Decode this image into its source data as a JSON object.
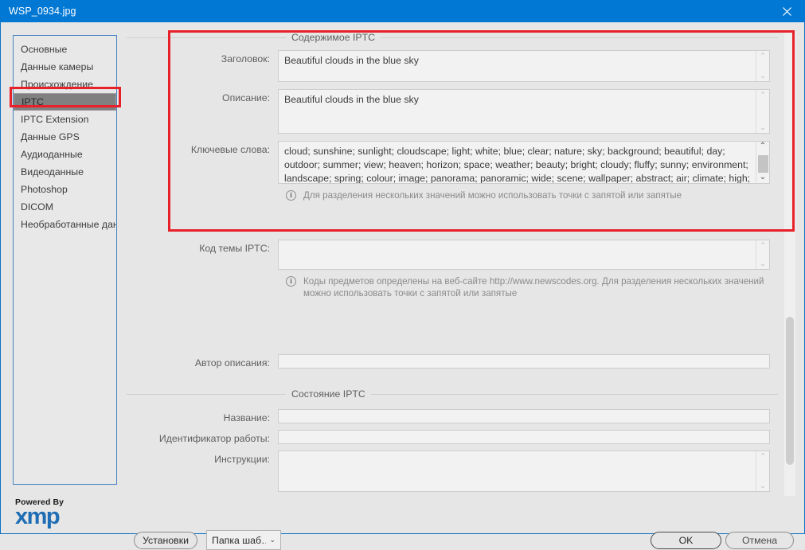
{
  "window": {
    "title": "WSP_0934.jpg",
    "close_icon": "close-icon",
    "titlebar_color": "#0078d4"
  },
  "sidebar": {
    "items": [
      {
        "label": "Основные",
        "selected": false
      },
      {
        "label": "Данные камеры",
        "selected": false
      },
      {
        "label": "Происхождение",
        "selected": false
      },
      {
        "label": "IPTC",
        "selected": true
      },
      {
        "label": "IPTC Extension",
        "selected": false
      },
      {
        "label": "Данные GPS",
        "selected": false
      },
      {
        "label": "Аудиоданные",
        "selected": false
      },
      {
        "label": "Видеоданные",
        "selected": false
      },
      {
        "label": "Photoshop",
        "selected": false
      },
      {
        "label": "DICOM",
        "selected": false
      },
      {
        "label": "Необработанные дан…",
        "selected": false
      }
    ],
    "selected_highlight_color": "#808080"
  },
  "branding": {
    "powered_by": "Powered By",
    "product": "xmp",
    "product_color": "#1f6eb5"
  },
  "sections": {
    "content": {
      "heading": "Содержимое IPTC",
      "fields": {
        "headline_label": "Заголовок:",
        "headline_value": "Beautiful clouds in the blue sky",
        "description_label": "Описание:",
        "description_value": "Beautiful clouds in the blue sky",
        "keywords_label": "Ключевые слова:",
        "keywords_value": "cloud; sunshine; sunlight; cloudscape; light; white; blue; clear; nature; sky; background; beautiful; day; outdoor; summer; view; heaven; horizon; space; weather; beauty; bright; cloudy; fluffy; sunny; environment; landscape; spring; colour; image; panorama; panoramic; wide; scene; wallpaper; abstract; air; climate; high; scenic; color; texture; season; winter; cyan; freedom; front; gradient; moisture; outside",
        "keywords_hint": "Для разделения нескольких значений можно использовать точки с запятой или запятые",
        "subject_code_label": "Код темы IPTC:",
        "subject_code_value": "",
        "subject_code_hint": "Коды предметов определены на веб-сайте http://www.newscodes.org. Для разделения нескольких значений можно использовать точки с запятой или запятые",
        "description_writer_label": "Автор описания:",
        "description_writer_value": ""
      }
    },
    "status": {
      "heading": "Состояние IPTC",
      "fields": {
        "title_label": "Название:",
        "title_value": "",
        "job_id_label": "Идентификатор работы:",
        "job_id_value": "",
        "instructions_label": "Инструкции:",
        "instructions_value": ""
      }
    }
  },
  "footer": {
    "preferences_label": "Установки",
    "template_folder_label": "Папка шаб…",
    "template_chevron": "⌄",
    "ok_label": "OK",
    "cancel_label": "Отмена"
  },
  "hint_icon": "info-icon",
  "scrollbars": {
    "spinner_up": "⌃",
    "spinner_down": "⌄",
    "arrow_up": "⌃",
    "arrow_down": "⌄"
  },
  "annotations": {
    "accent_color": "#e8202a",
    "boxes": [
      "sidebar-iptc-item",
      "iptc-content-section"
    ]
  }
}
